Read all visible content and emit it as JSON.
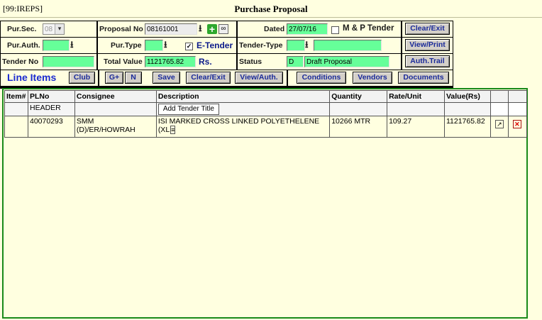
{
  "header": {
    "code": "[99:IREPS]",
    "title": "Purchase Proposal"
  },
  "form": {
    "pur_sec_label": "Pur.Sec.",
    "pur_sec_value": "08",
    "proposal_no_label": "Proposal No",
    "proposal_no_value": "08161001",
    "dated_label": "Dated",
    "dated_value": "27/07/16",
    "mp_tender_label": "M & P Tender",
    "pur_auth_label": "Pur.Auth.",
    "pur_type_label": "Pur.Type",
    "e_tender_checkbox": "✓",
    "e_tender_label": "E-Tender",
    "tender_type_label": "Tender-Type",
    "tender_no_label": "Tender No",
    "total_value_label": "Total Value",
    "total_value_value": "1121765.82",
    "currency": "Rs.",
    "status_label": "Status",
    "status_code": "D",
    "status_text": "Draft Proposal"
  },
  "buttons": {
    "clear_exit_top": "Clear/Exit",
    "view_print": "View/Print",
    "auth_trail": "Auth.Trail",
    "club": "Club",
    "g_plus": "G+",
    "n": "N",
    "save": "Save",
    "clear_exit": "Clear/Exit",
    "view_auth": "View/Auth.",
    "conditions": "Conditions",
    "vendors": "Vendors",
    "documents": "Documents"
  },
  "line_items_label": "Line Items",
  "grid": {
    "columns": [
      "Item#",
      "PLNo",
      "Consignee",
      "Description",
      "Quantity",
      "Rate/Unit",
      "Value(Rs)"
    ],
    "header_row": {
      "plno": "HEADER",
      "description_button": "Add Tender Title"
    },
    "rows": [
      {
        "item": "",
        "plno": "40070293",
        "consignee": "SMM (D)/ER/HOWRAH",
        "description": "ISI MARKED CROSS LINKED POLYETHELENE (XL",
        "quantity": "10266 MTR",
        "rate": "109.27",
        "value": "1121765.82"
      }
    ]
  },
  "colors": {
    "accent_green": "#66ff99",
    "label_blue": "#1a2ad0",
    "border_green": "#1a8a1a"
  }
}
